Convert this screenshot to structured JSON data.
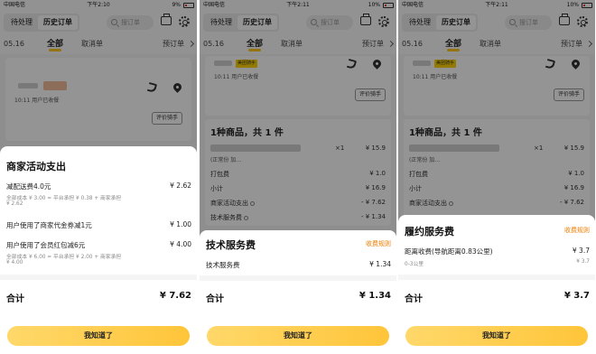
{
  "panels": [
    {
      "status": {
        "carrier": "中国电信",
        "time": "下午2:10",
        "battery": "9%"
      },
      "header": {
        "tab_pending": "待处理",
        "tab_history": "历史订单",
        "search_placeholder": "搜订单"
      },
      "filters": {
        "date": "05.16",
        "tab_all": "全部",
        "tab_cancel": "取消单",
        "preorder": "预订单"
      },
      "order": {
        "time_status": "10:11  用户已收餐",
        "rate_button": "评价骑手"
      },
      "sheet": {
        "title": "商家活动支出",
        "items": [
          {
            "label": "减配送费4.0元",
            "value": "¥ 2.62",
            "detail_1": "全部成本 ¥ 3.00 = 平台承担 ¥ 0.38 + 商家承担",
            "detail_2": "¥ 2.62"
          },
          {
            "label": "用户使用了商家代金券减1元",
            "value": "¥ 1.00"
          },
          {
            "label": "用户使用了会员红包减6元",
            "value": "¥ 4.00",
            "detail_1": "全部成本 ¥ 6.00 = 平台承担 ¥ 2.00 + 商家承担",
            "detail_2": "¥ 4.00"
          }
        ],
        "total_label": "合计",
        "total_value": "¥ 7.62",
        "ok_button": "我知道了"
      }
    },
    {
      "status": {
        "carrier": "中国电信",
        "time": "下午2:11",
        "battery": "10%"
      },
      "header": {
        "tab_pending": "待处理",
        "tab_history": "历史订单",
        "search_placeholder": "搜订单"
      },
      "filters": {
        "date": "05.16",
        "tab_all": "全部",
        "tab_cancel": "取消单",
        "preorder": "预订单"
      },
      "order": {
        "badge": "美团骑手",
        "time_status": "10:11  用户已收餐",
        "rate_button": "评价骑手",
        "goods_summary": "1种商品，共 1 件",
        "item_qty": "×1",
        "item_price": "¥ 15.9",
        "item_spec": "(正常份 加…",
        "rows": [
          {
            "label": "打包费",
            "value": "¥ 1.0"
          },
          {
            "label": "小计",
            "value": "¥ 16.9"
          },
          {
            "label": "商家活动支出",
            "value": "- ¥ 7.62"
          },
          {
            "label": "技术服务费",
            "value": "- ¥ 1.34"
          }
        ]
      },
      "sheet": {
        "title": "技术服务费",
        "rule_link": "收费规则",
        "items": [
          {
            "label": "技术服务费",
            "value": "¥ 1.34"
          }
        ],
        "total_label": "合计",
        "total_value": "¥ 1.34",
        "ok_button": "我知道了"
      }
    },
    {
      "status": {
        "carrier": "中国电信",
        "time": "下午2:11",
        "battery": "10%"
      },
      "header": {
        "tab_pending": "待处理",
        "tab_history": "历史订单",
        "search_placeholder": "搜订单"
      },
      "filters": {
        "date": "05.16",
        "tab_all": "全部",
        "tab_cancel": "取消单",
        "preorder": "预订单"
      },
      "order": {
        "badge": "美团骑手",
        "time_status": "10:11  用户已收餐",
        "rate_button": "评价骑手",
        "goods_summary": "1种商品，共 1 件",
        "item_qty": "×1",
        "item_price": "¥ 15.9",
        "item_spec": "(正常份 加…",
        "rows": [
          {
            "label": "打包费",
            "value": "¥ 1.0"
          },
          {
            "label": "小计",
            "value": "¥ 16.9"
          },
          {
            "label": "商家活动支出",
            "value": "- ¥ 7.62"
          }
        ]
      },
      "sheet": {
        "title": "履约服务费",
        "rule_link": "收费规则",
        "items": [
          {
            "label": "距离收费(导航距离0.83公里)",
            "value": "¥ 3.7",
            "detail_1": "0-3公里",
            "detail_2": "¥ 3.7"
          }
        ],
        "total_label": "合计",
        "total_value": "¥ 3.7",
        "ok_button": "我知道了"
      }
    }
  ]
}
